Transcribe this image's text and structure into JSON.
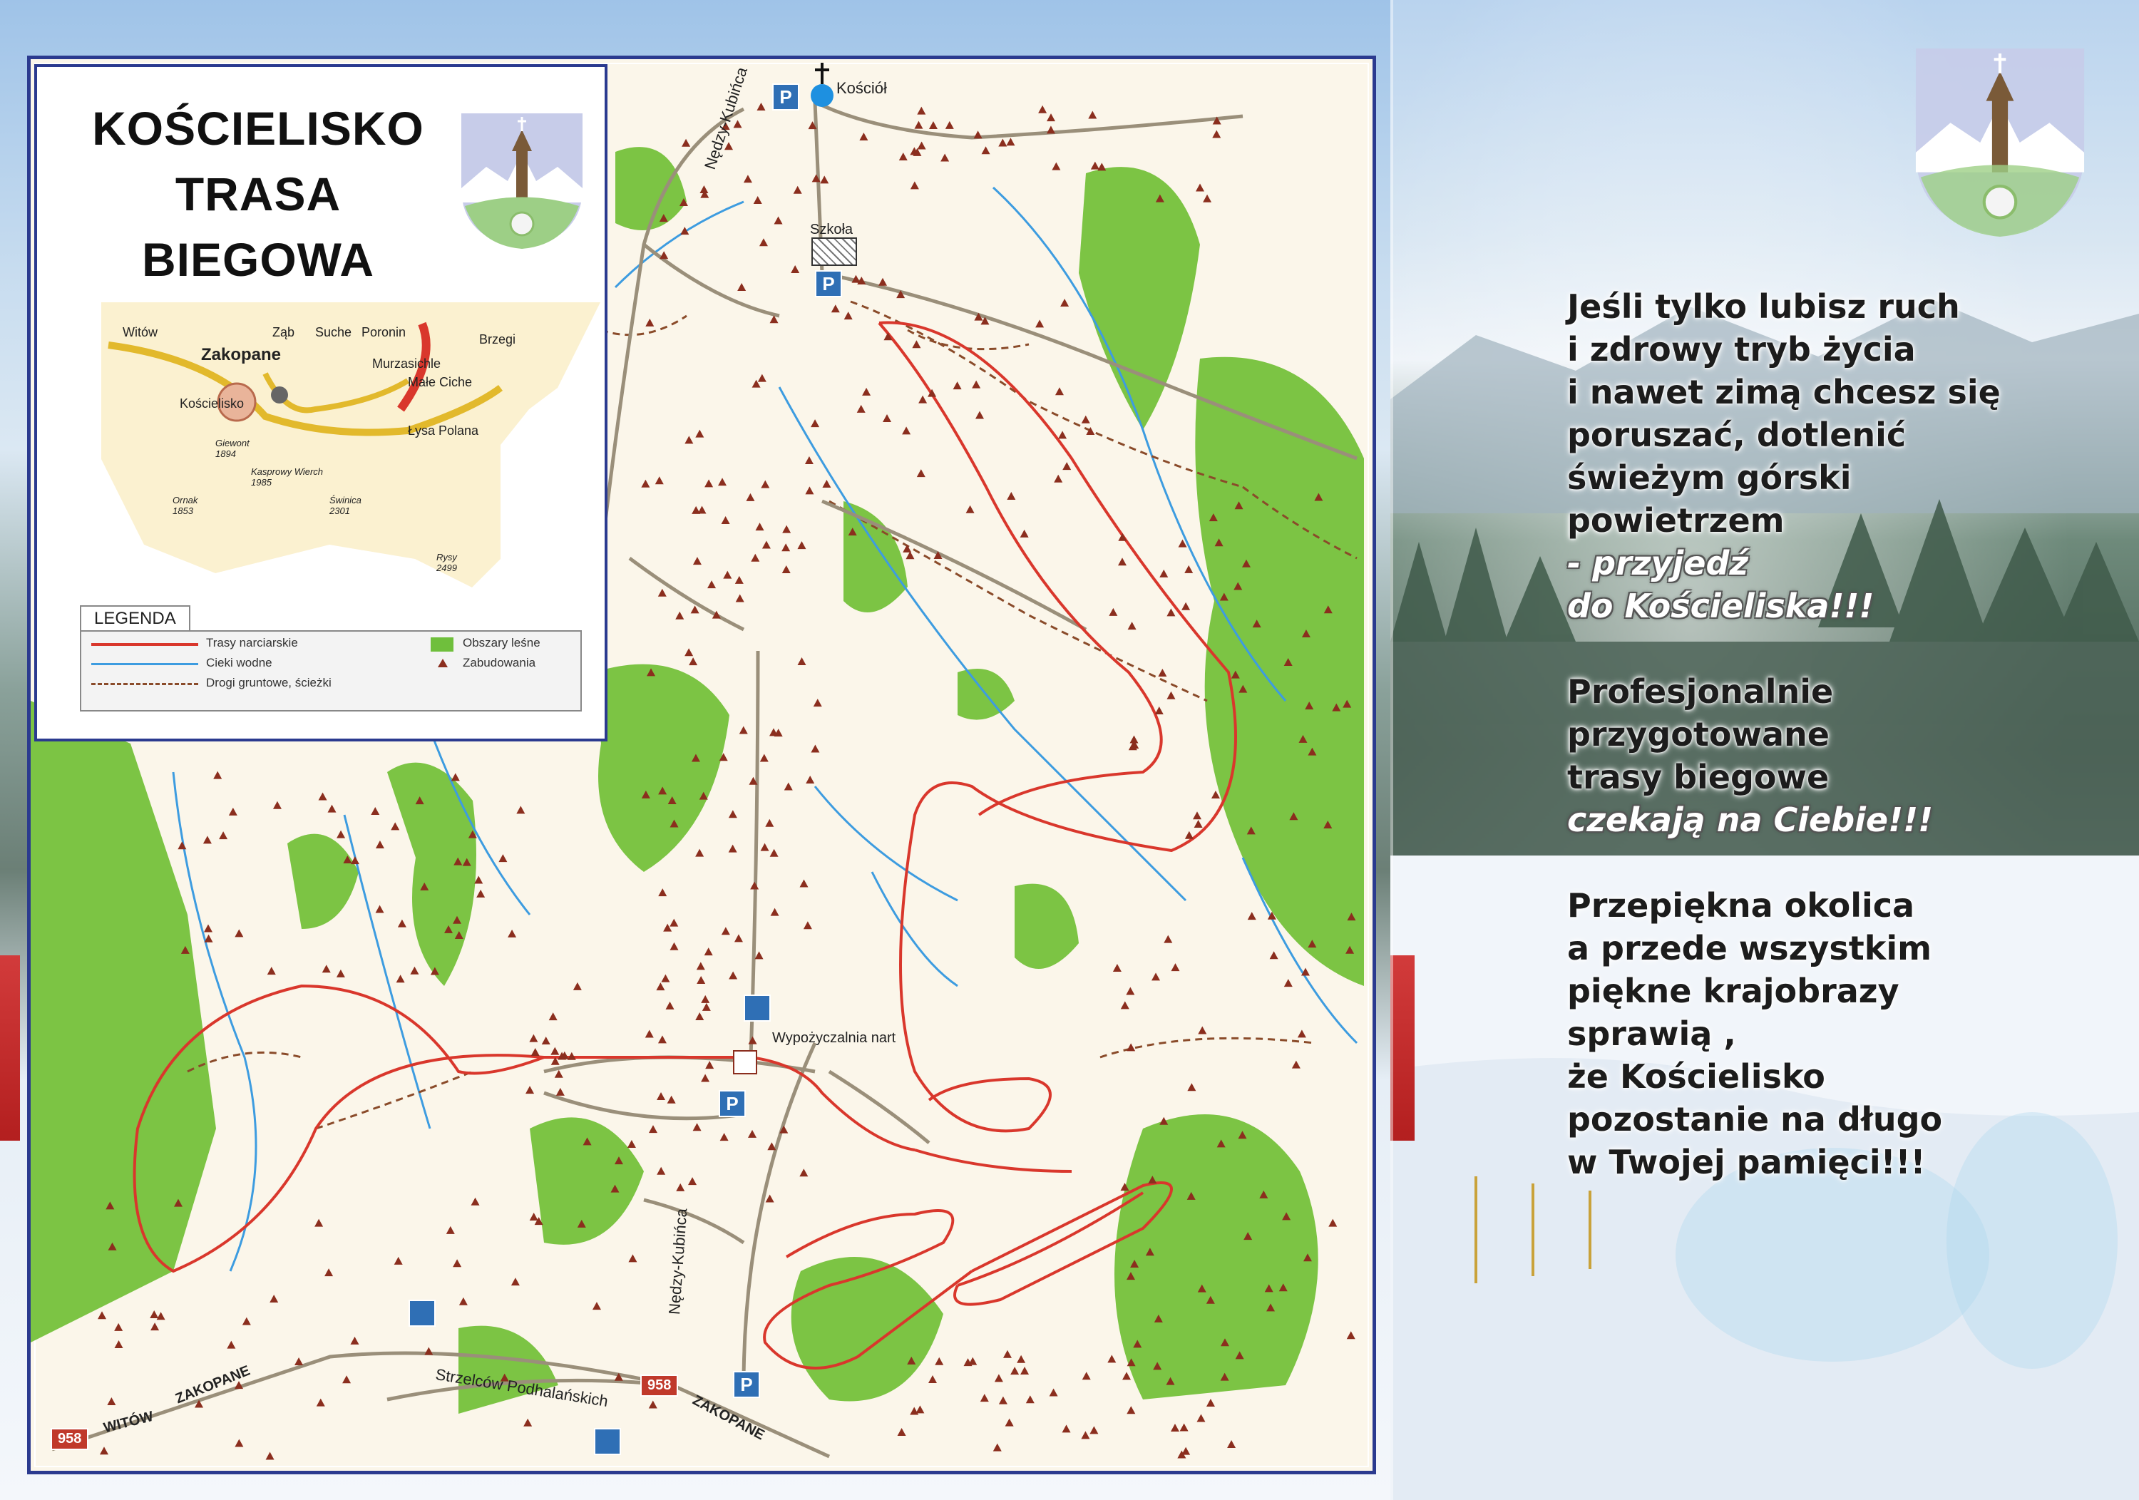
{
  "title": {
    "line1": "KOŚCIELISKO",
    "line2": "TRASA",
    "line3": "BIEGOWA"
  },
  "inset_map": {
    "places": [
      "Witów",
      "Zakopane",
      "Ząb",
      "Suche",
      "Poronin",
      "Brzegi",
      "Murzasichle",
      "Małe Ciche",
      "Kościelisko",
      "Łysa Polana"
    ],
    "peaks": [
      {
        "name": "Giewont",
        "elev": "1894"
      },
      {
        "name": "Kasprowy Wierch",
        "elev": "1985"
      },
      {
        "name": "Ornak",
        "elev": "1853"
      },
      {
        "name": "Świnica",
        "elev": "2301"
      },
      {
        "name": "Rysy",
        "elev": "2499"
      }
    ]
  },
  "legend": {
    "title": "LEGENDA",
    "items": [
      {
        "label": "Trasy narciarskie",
        "color": "#d9372c"
      },
      {
        "label": "Cieki wodne",
        "color": "#3d9ce0"
      },
      {
        "label": "Drogi gruntowe, ścieżki",
        "color": "#8a4b2a"
      },
      {
        "label": "Obszary leśne",
        "color": "#6fbf3c"
      },
      {
        "label": "Zabudowania",
        "color": "#8b2e1e"
      }
    ]
  },
  "map_labels": {
    "church": "Kościół",
    "school": "Szkoła",
    "street_north": "Nędzy-Kubińca",
    "street_south": "Nędzy-Kubińca",
    "rental": "Wypożyczalnia nart",
    "main_road": "Strzelców Podhalańskich",
    "dir_witow": "WITÓW",
    "dir_zakopane_w": "ZAKOPANE",
    "dir_zakopane_e": "ZAKOPANE",
    "road_number_1": "958",
    "road_number_2": "958",
    "parking": "P"
  },
  "promo": {
    "p1": [
      "Jeśli tylko lubisz ruch",
      "i zdrowy tryb życia",
      "i nawet zimą chcesz się",
      "poruszać, dotlenić",
      "świeżym górski",
      "powietrzem"
    ],
    "p1_highlight": [
      "- przyjedź",
      "do Kościeliska!!!"
    ],
    "p2": [
      "Profesjonalnie",
      "przygotowane",
      "trasy biegowe"
    ],
    "p2_highlight": [
      "czekają na Ciebie!!!"
    ],
    "p3": [
      "Przepiękna okolica",
      "a przede wszystkim",
      "piękne krajobrazy",
      "sprawią ,",
      "że Kościelisko",
      "pozostanie na długo",
      "w Twojej pamięci!!!"
    ]
  },
  "colors": {
    "frame": "#2b3a8f",
    "trail": "#d9372c",
    "water": "#3d9ce0",
    "forest": "#6fbf3c",
    "path": "#8a4b2a",
    "building": "#8b2e1e"
  }
}
